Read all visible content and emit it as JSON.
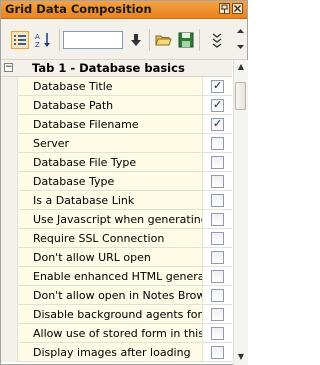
{
  "panel": {
    "title": "Grid Data Composition",
    "title_buttons": [
      "pin-icon",
      "close-icon"
    ]
  },
  "toolbar": {
    "icons": [
      "categorized-view-icon",
      "sort-az-icon",
      "arrow-down-icon",
      "open-folder-icon",
      "save-icon",
      "more-chevron-icon"
    ],
    "combo_value": ""
  },
  "section": {
    "label": "Tab 1 - Database basics",
    "toggle_symbol": "−"
  },
  "properties": [
    {
      "label": "Database Title",
      "checked": true
    },
    {
      "label": "Database Path",
      "checked": true
    },
    {
      "label": "Database Filename",
      "checked": true
    },
    {
      "label": "Server",
      "checked": false
    },
    {
      "label": "Database File Type",
      "checked": false
    },
    {
      "label": "Database Type",
      "checked": false
    },
    {
      "label": "Is a Database Link",
      "checked": false
    },
    {
      "label": "Use Javascript when generating pa",
      "checked": false
    },
    {
      "label": "Require SSL Connection",
      "checked": false
    },
    {
      "label": "Don't allow URL open",
      "checked": false
    },
    {
      "label": "Enable enhanced HTML generation",
      "checked": false
    },
    {
      "label": "Don't allow open in Notes Browser",
      "checked": false
    },
    {
      "label": "Disable background agents for this",
      "checked": false
    },
    {
      "label": "Allow use of stored form in this dat",
      "checked": false
    },
    {
      "label": "Display images after loading",
      "checked": false
    }
  ],
  "colors": {
    "title_bar": "#e7831f",
    "row_background": "#fffbe6",
    "gutter": "#f3f1ea"
  }
}
